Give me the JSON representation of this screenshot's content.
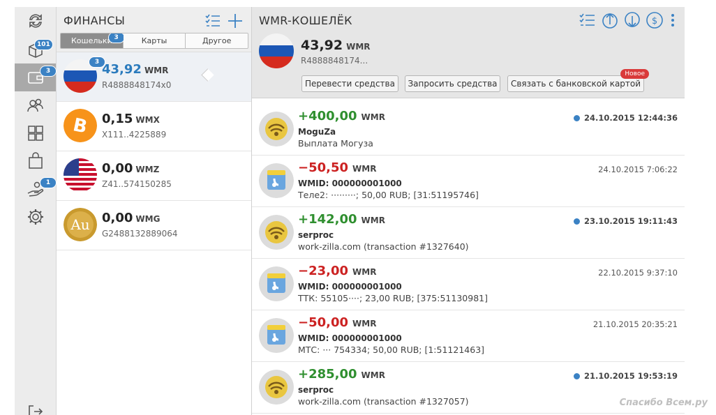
{
  "rail": {
    "badges": {
      "messages": "101",
      "wallets": "3",
      "requests": "1"
    }
  },
  "finances": {
    "title": "ФИНАНСЫ",
    "tabs": [
      {
        "label": "Кошельки",
        "badge": "3"
      },
      {
        "label": "Карты"
      },
      {
        "label": "Другое"
      }
    ],
    "wallets": [
      {
        "amount": "43,92",
        "currency": "WMR",
        "number": "R4888848174x0",
        "badge": "3"
      },
      {
        "amount": "0,15",
        "currency": "WMX",
        "number": "X111..4225889"
      },
      {
        "amount": "0,00",
        "currency": "WMZ",
        "number": "Z41..574150285"
      },
      {
        "amount": "0,00",
        "currency": "WMG",
        "number": "G2488132889064"
      }
    ]
  },
  "wmr": {
    "title": "WMR-КОШЕЛЁК",
    "amount": "43,92",
    "currency": "WMR",
    "number": "R4888848174...",
    "buttons": {
      "transfer": "Перевести средства",
      "request": "Запросить средства",
      "bank": "Связать с банковской картой",
      "bank_badge": "Новое"
    }
  },
  "transactions": [
    {
      "amount": "+400,00",
      "currency": "WMR",
      "name": "MoguZa",
      "desc": "Выплата Могуза",
      "date": "24.10.2015 12:44:36",
      "new": true
    },
    {
      "amount": "−50,50",
      "currency": "WMR",
      "name": "WMID: 000000001000",
      "desc": "Теле2:   ·········; 50,00 RUB; [31:51195746]",
      "date": "24.10.2015 7:06:22",
      "new": false
    },
    {
      "amount": "+142,00",
      "currency": "WMR",
      "name": "serproc",
      "desc": "work-zilla.com (transaction #1327640)",
      "date": "23.10.2015 19:11:43",
      "new": true
    },
    {
      "amount": "−23,00",
      "currency": "WMR",
      "name": "WMID: 000000001000",
      "desc": "ТТК: 55105····; 23,00 RUB; [375:51130981]",
      "date": "22.10.2015 9:37:10",
      "new": false
    },
    {
      "amount": "−50,00",
      "currency": "WMR",
      "name": "WMID: 000000001000",
      "desc": "МТС:  ··· 754334; 50,00 RUB; [1:51121463]",
      "date": "21.10.2015 20:35:21",
      "new": false
    },
    {
      "amount": "+285,00",
      "currency": "WMR",
      "name": "serproc",
      "desc": "work-zilla.com (transaction #1327057)",
      "date": "21.10.2015 19:53:19",
      "new": true
    }
  ],
  "watermark": "Спасибо Всем.ру",
  "colors": {
    "accent": "#3b82c4",
    "positive": "#2f8f2f",
    "negative": "#cc2222",
    "badge_new": "#d93a3a"
  }
}
